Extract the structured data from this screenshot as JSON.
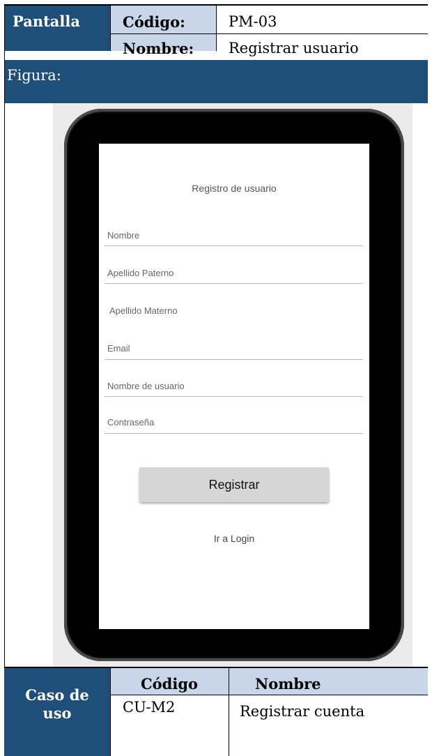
{
  "header": {
    "label": "Pantalla",
    "codigo_label": "Código:",
    "codigo_value": "PM-03",
    "nombre_label": "Nombre:",
    "nombre_value": "Registrar usuario"
  },
  "figura_label": "Figura:",
  "mockup": {
    "title": "Registro de usuario",
    "fields": [
      "Nombre",
      "Apellido Paterno",
      "Apellido Materno",
      "Email",
      "Nombre de usuario",
      "Contraseña"
    ],
    "register_button": "Registrar",
    "login_link": "Ir a Login"
  },
  "footer": {
    "label_line1": "Caso de",
    "label_line2": "uso",
    "codigo_header": "Código",
    "nombre_header": "Nombre",
    "codigo_value": "CU-M2",
    "nombre_value": "Registrar cuenta"
  }
}
